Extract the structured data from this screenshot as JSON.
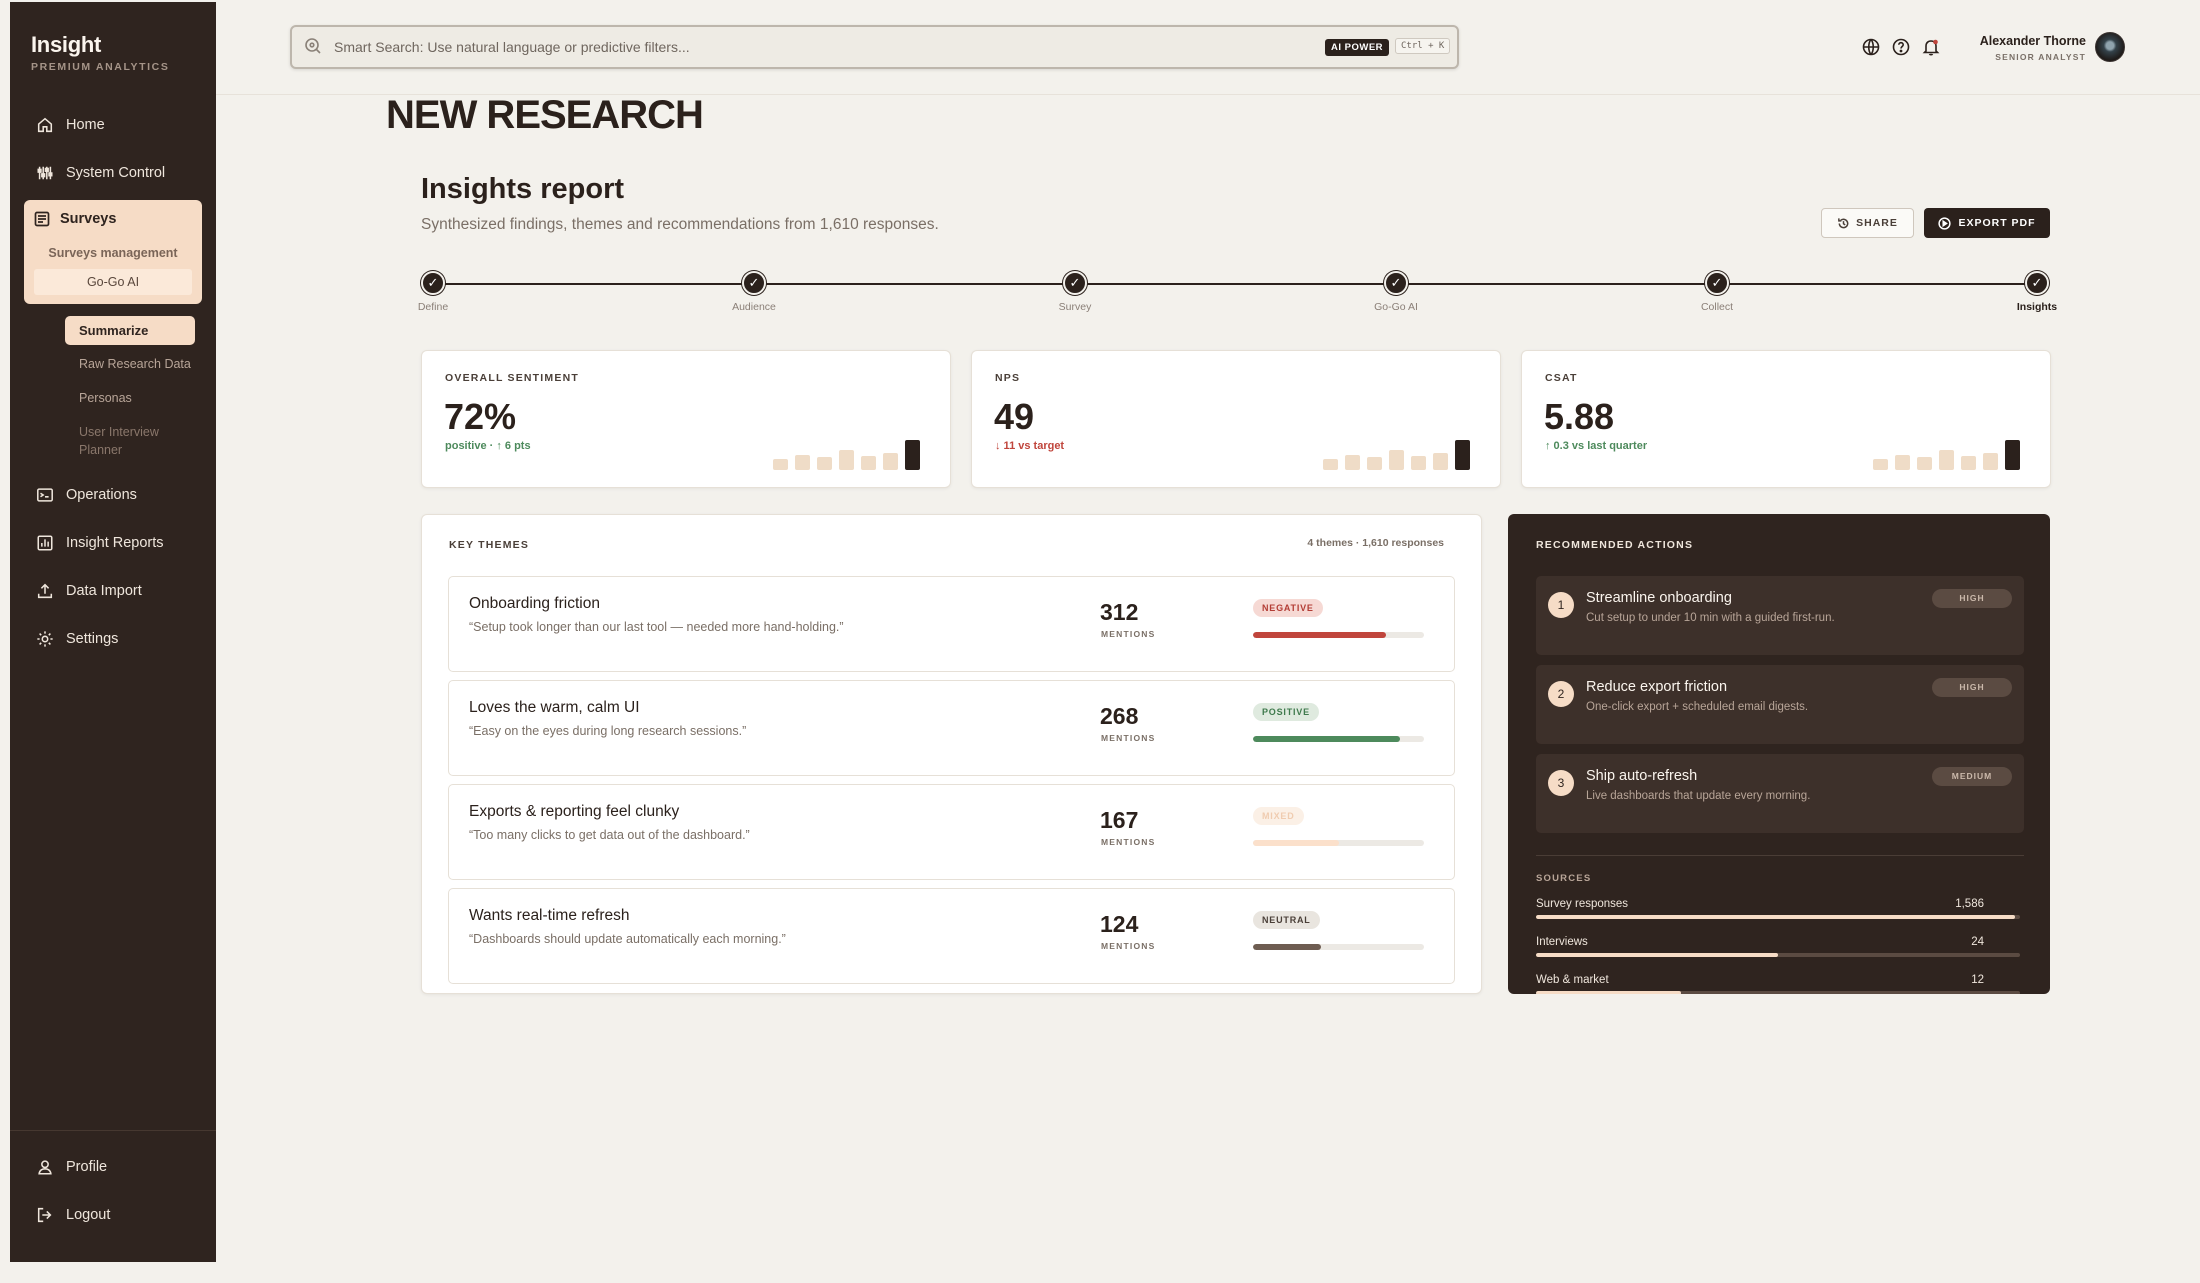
{
  "brand": {
    "title": "Insight",
    "subtitle": "PREMIUM ANALYTICS"
  },
  "sidebar": {
    "home": "Home",
    "system_control": "System Control",
    "surveys": "Surveys",
    "surveys_management": "Surveys management",
    "gogo_ai": "Go-Go AI",
    "summarize": "Summarize",
    "raw_research_data": "Raw Research Data",
    "personas": "Personas",
    "user_interview_planner": "User Interview Planner",
    "operations": "Operations",
    "insight_reports": "Insight Reports",
    "data_import": "Data Import",
    "settings": "Settings",
    "profile": "Profile",
    "logout": "Logout"
  },
  "search": {
    "placeholder": "Smart Search: Use natural language or predictive filters...",
    "badge": "AI POWER",
    "shortcut": "Ctrl + K"
  },
  "user": {
    "name": "Alexander Thorne",
    "role": "SENIOR ANALYST"
  },
  "page": {
    "title": "NEW RESEARCH",
    "report_title": "Insights report",
    "report_subtitle": "Synthesized findings, themes and recommendations from 1,610 responses.",
    "share": "SHARE",
    "export": "EXPORT PDF"
  },
  "steps": [
    "Define",
    "Audience",
    "Survey",
    "Go-Go AI",
    "Collect",
    "Insights"
  ],
  "step_check": "✓",
  "metrics": [
    {
      "label": "OVERALL SENTIMENT",
      "value": "72%",
      "delta": "positive · ↑ 6 pts",
      "trend": "positive",
      "spark": [
        0.35,
        0.5,
        0.42,
        0.65,
        0.48,
        0.55,
        1.0
      ]
    },
    {
      "label": "NPS",
      "value": "49",
      "delta": "↓ 11 vs target",
      "trend": "negative",
      "spark": [
        0.35,
        0.5,
        0.42,
        0.65,
        0.48,
        0.55,
        1.0
      ]
    },
    {
      "label": "CSAT",
      "value": "5.88",
      "delta": "↑ 0.3 vs last quarter",
      "trend": "positive",
      "spark": [
        0.35,
        0.5,
        0.42,
        0.65,
        0.48,
        0.55,
        1.0
      ]
    }
  ],
  "themes": {
    "label": "KEY THEMES",
    "meta": "4 themes · 1,610 responses",
    "mentions_label": "MENTIONS",
    "items": [
      {
        "title": "Onboarding friction",
        "quote": "“Setup took longer than our last tool — needed more hand-holding.”",
        "count": "312",
        "sentiment": "NEGATIVE",
        "kind": "negative",
        "share": 0.78,
        "color": "#c0453c"
      },
      {
        "title": "Loves the warm, calm UI",
        "quote": "“Easy on the eyes during long research sessions.”",
        "count": "268",
        "sentiment": "POSITIVE",
        "kind": "positive",
        "share": 0.86,
        "color": "#4d8a5c"
      },
      {
        "title": "Exports & reporting feel clunky",
        "quote": "“Too many clicks to get data out of the dashboard.”",
        "count": "167",
        "sentiment": "MIXED",
        "kind": "mixed",
        "share": 0.5,
        "color": "#fbe0cb"
      },
      {
        "title": "Wants real-time refresh",
        "quote": "“Dashboards should update automatically each morning.”",
        "count": "124",
        "sentiment": "NEUTRAL",
        "kind": "neutral",
        "share": 0.4,
        "color": "#6e5d52"
      }
    ]
  },
  "actions": {
    "label": "RECOMMENDED ACTIONS",
    "items": [
      {
        "num": "1",
        "title": "Streamline onboarding",
        "desc": "Cut setup to under 10 min with a guided first-run.",
        "priority": "HIGH"
      },
      {
        "num": "2",
        "title": "Reduce export friction",
        "desc": "One-click export + scheduled email digests.",
        "priority": "HIGH"
      },
      {
        "num": "3",
        "title": "Ship auto-refresh",
        "desc": "Live dashboards that update every morning.",
        "priority": "MEDIUM"
      }
    ],
    "sources_label": "SOURCES",
    "sources": [
      {
        "name": "Survey responses",
        "value": "1,586",
        "share": 0.99
      },
      {
        "name": "Interviews",
        "value": "24",
        "share": 0.5
      },
      {
        "name": "Web & market",
        "value": "12",
        "share": 0.3
      }
    ]
  }
}
